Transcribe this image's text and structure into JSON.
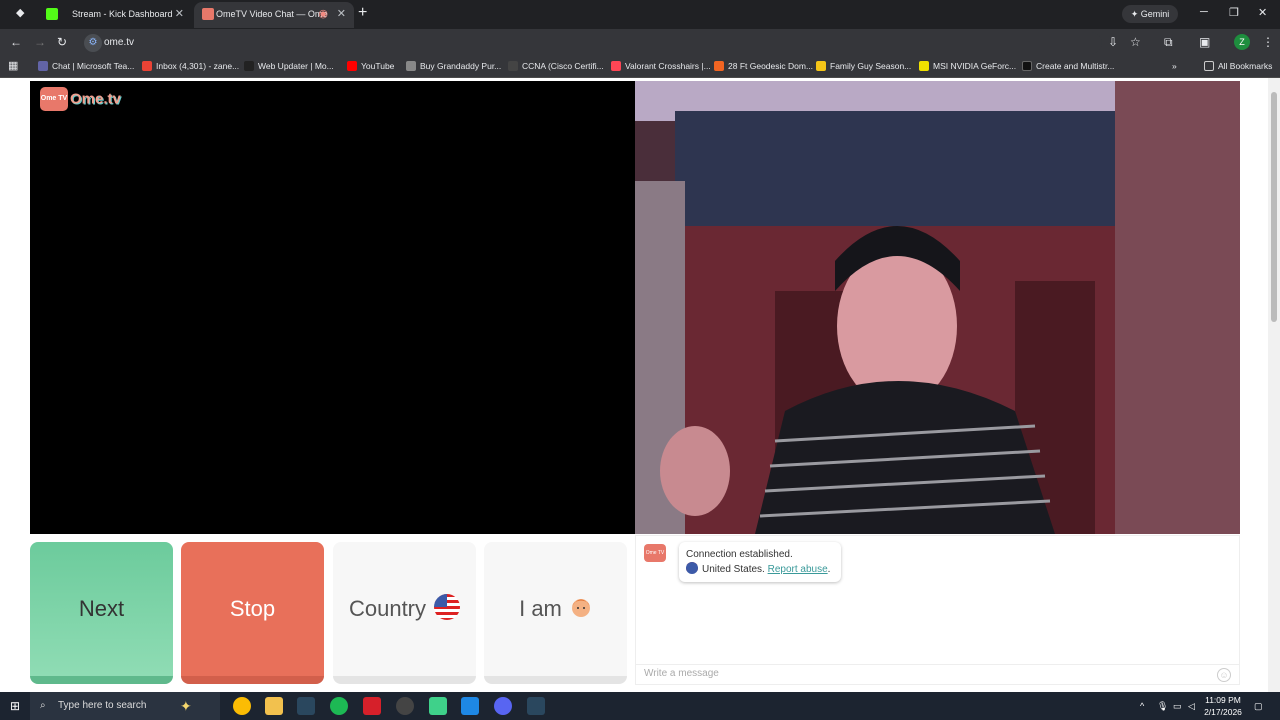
{
  "browser": {
    "tabs": [
      {
        "title": "Stream - Kick Dashboard",
        "favicon_color": "#53fc18"
      },
      {
        "title": "OmeTV Video Chat — Ome",
        "favicon_color": "#e8786a"
      }
    ],
    "gemini_label": "Gemini",
    "url": "ome.tv",
    "profile_initial": "Z",
    "bookmarks": [
      {
        "label": "Chat | Microsoft Tea...",
        "color": "#6264a7"
      },
      {
        "label": "Inbox (4,301) - zane...",
        "color": "#ea4335"
      },
      {
        "label": "Web Updater | Mo...",
        "color": "#222222"
      },
      {
        "label": "YouTube",
        "color": "#ff0000"
      },
      {
        "label": "Buy Grandaddy Pur...",
        "color": "#888888"
      },
      {
        "label": "CCNA (Cisco Certifi...",
        "color": "#444444"
      },
      {
        "label": "Valorant Crosshairs |...",
        "color": "#ff4655"
      },
      {
        "label": "28 Ft Geodesic Dom...",
        "color": "#f26522"
      },
      {
        "label": "Family Guy Season...",
        "color": "#f5c518"
      },
      {
        "label": "MSI NVIDIA GeForc...",
        "color": "#f0e000"
      },
      {
        "label": "Create and Multistr...",
        "color": "#111111"
      }
    ],
    "all_bookmarks": "All Bookmarks"
  },
  "site": {
    "logo_box": "Ome TV",
    "logo_text": "Ome.tv",
    "buttons": {
      "next": "Next",
      "stop": "Stop",
      "country": "Country",
      "iam": "I am"
    },
    "chat": {
      "logo": "Ome TV",
      "status": "Connection established.",
      "country": "United States.",
      "report": "Report abuse",
      "period": ".",
      "placeholder": "Write a message"
    }
  },
  "taskbar": {
    "search_placeholder": "Type here to search",
    "time": "11:09 PM",
    "date": "2/17/2026"
  },
  "colors": {
    "next": "#6ccb9c",
    "stop": "#e8705a",
    "accent": "#3a9a9a"
  }
}
